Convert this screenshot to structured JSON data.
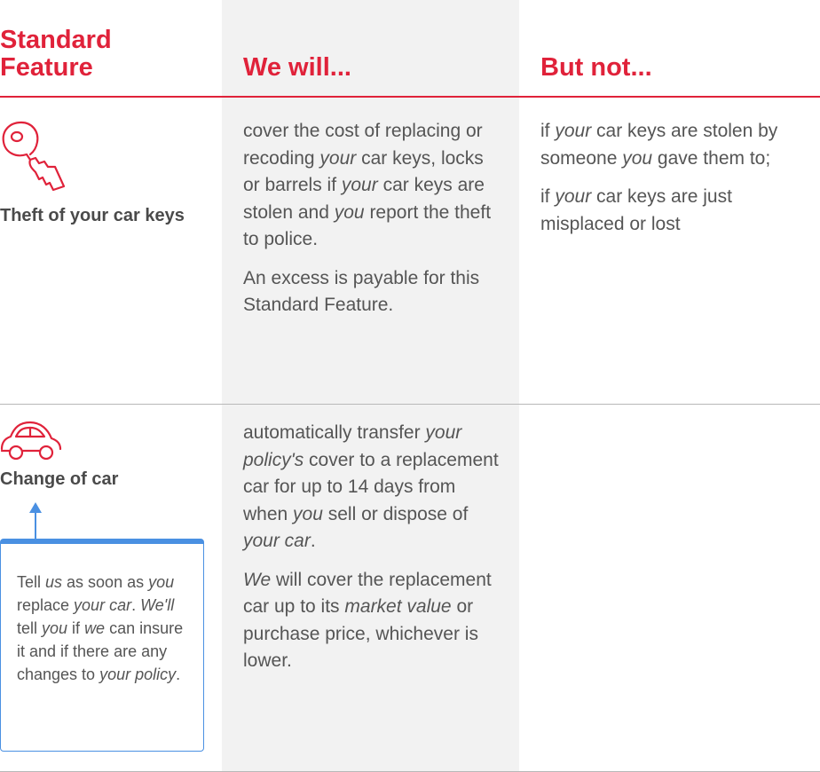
{
  "header": {
    "feature_line1": "Standard",
    "feature_line2": "Feature",
    "will": "We will...",
    "not": "But not..."
  },
  "rows": [
    {
      "feature": "Theft of your car keys",
      "will": {
        "p1": [
          "cover the cost of replacing or recoding ",
          "your",
          " car keys, locks or barrels if ",
          "your",
          " car keys are stolen and ",
          "you",
          " report the theft to police."
        ],
        "p2": "An excess is payable for this Standard Feature."
      },
      "not": {
        "p1": [
          "if ",
          "your",
          " car keys are stolen by someone ",
          "you",
          " gave them to;"
        ],
        "p2": [
          "if ",
          "your",
          " car keys are just misplaced or lost"
        ]
      }
    },
    {
      "feature": "Change of car",
      "will": {
        "p1": [
          "automatically transfer ",
          "your policy's",
          " cover to a replacement car for up to 14 days from when ",
          "you",
          " sell or dispose of ",
          "your car",
          "."
        ],
        "p2": [
          "We",
          " will cover the replacement car up to its ",
          "market value",
          " or purchase price, whichever is lower."
        ]
      },
      "callout": [
        "Tell ",
        "us",
        " as soon as ",
        "you",
        " replace ",
        "your car",
        ". ",
        "We'll",
        " tell ",
        "you",
        " if ",
        "we",
        " can insure it and if there are any changes to ",
        "your policy",
        "."
      ]
    }
  ],
  "colors": {
    "accent": "#e0223a",
    "callout": "#4a90e2"
  },
  "icons": [
    "key-icon",
    "car-icon",
    "arrow-up-icon"
  ]
}
